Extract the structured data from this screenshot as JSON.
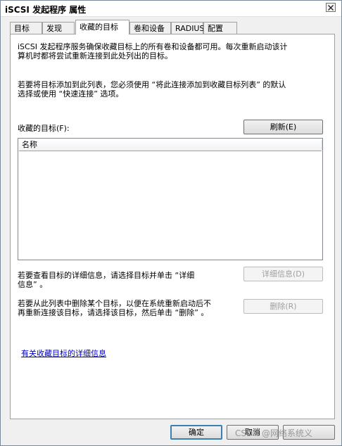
{
  "window": {
    "title": "iSCSI 发起程序 属性"
  },
  "tabs": [
    {
      "label": "目标",
      "active": false
    },
    {
      "label": "发现",
      "active": false
    },
    {
      "label": "收藏的目标",
      "active": true
    },
    {
      "label": "卷和设备",
      "active": false
    },
    {
      "label": "RADIUS",
      "active": false
    },
    {
      "label": "配置",
      "active": false
    }
  ],
  "panel": {
    "intro_line1": "iSCSI 发起程序服务确保收藏目标上的所有卷和设备都可用。每次重新启动该计",
    "intro_line2": "算机时都将尝试重新连接到此处列出的目标。",
    "add_line1": "若要将目标添加到此列表，您必须使用 “将此连接添加到收藏目标列表” 的默认",
    "add_line2": "选择或使用 “快速连接” 选项。",
    "favorites_label": "收藏的目标(F):",
    "refresh_button": "刷新(E)",
    "list_column_name": "名称",
    "details_line1": "若要查看目标的详细信息，请选择目标并单击 “详细",
    "details_line2": "信息” 。",
    "details_button": "详细信息(D)",
    "remove_line1": "若要从此列表中删除某个目标，以便在系统重新启动后不",
    "remove_line2": "再重新连接该目标，请选择该目标，然后单击 “删除” 。",
    "remove_button": "删除(R)",
    "more_info_link": "有关收藏目标的详细信息"
  },
  "footer": {
    "ok_button": "确定",
    "cancel_button": "取消",
    "watermark": "CSDN @网络系统义"
  }
}
